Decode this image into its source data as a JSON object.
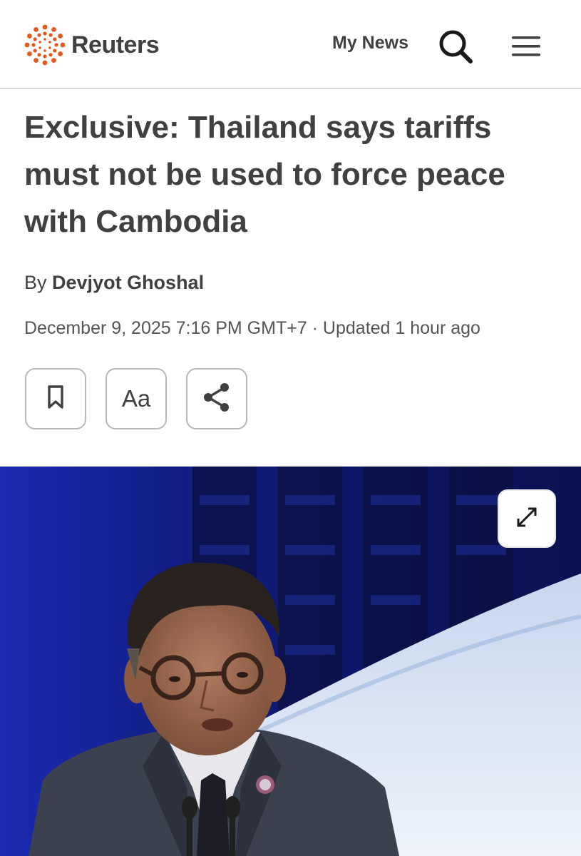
{
  "header": {
    "brand": "Reuters",
    "my_news_label": "My News",
    "brand_color": "#e05a1c",
    "icons": [
      "reuters-logo-icon",
      "search-icon",
      "hamburger-menu-icon"
    ]
  },
  "article": {
    "headline": "Exclusive: Thailand says tariffs must not be used to force peace with Cambodia",
    "byline_prefix": "By",
    "author": "Devjyot Ghoshal",
    "dateline": "December 9, 2025 7:16 PM GMT+7 · Updated 1 hour ago"
  },
  "actions": {
    "font_size_label": "Aa",
    "icons": [
      "bookmark-icon",
      "font-size-icon",
      "share-icon"
    ]
  },
  "photo": {
    "icons": [
      "expand-icon"
    ]
  }
}
